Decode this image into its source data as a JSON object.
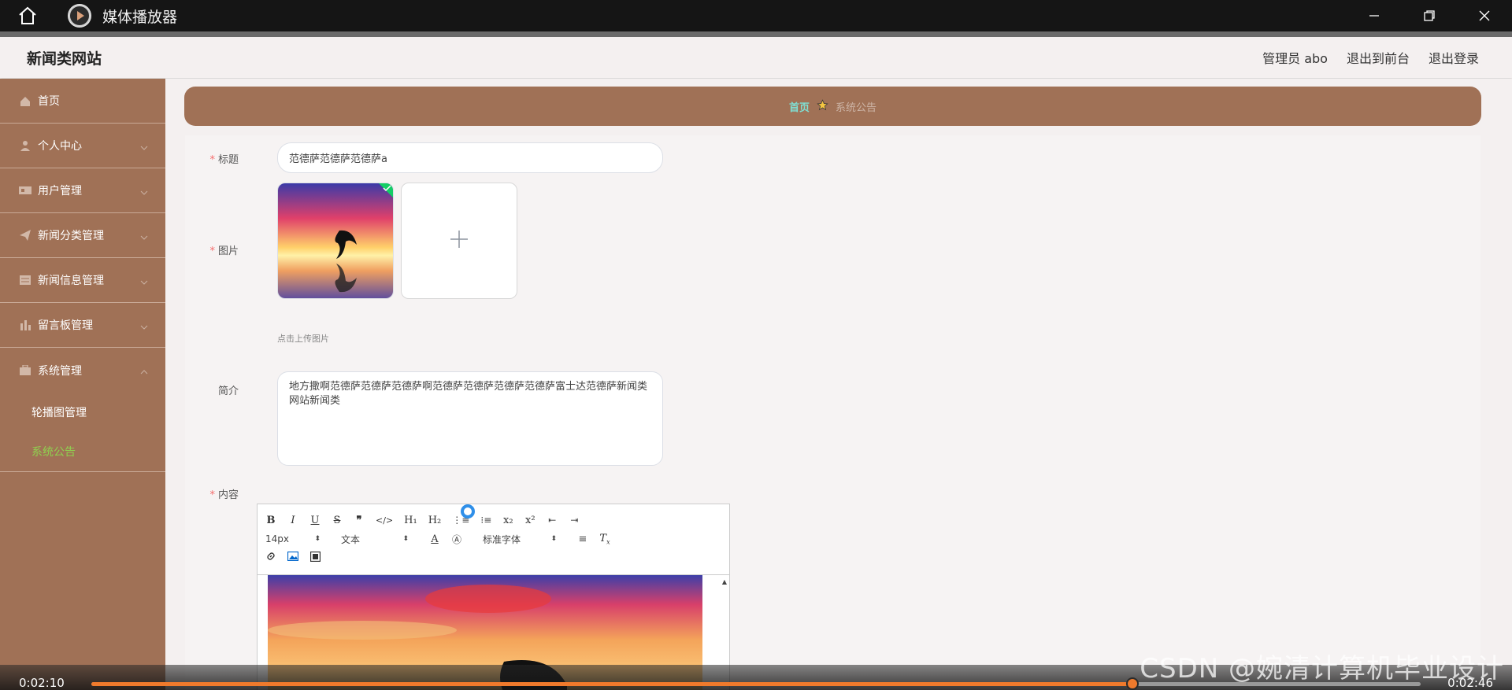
{
  "player": {
    "title": "媒体播放器",
    "current_time": "0:02:10",
    "total_time": "0:02:46",
    "progress": 0.783,
    "watermark": "CSDN @婉清计算机毕业设计"
  },
  "header": {
    "site_title": "新闻类网站",
    "admin": "管理员 abo",
    "to_front": "退出到前台",
    "logout": "退出登录"
  },
  "sidebar": {
    "items": [
      {
        "label": "首页",
        "icon": "home-icon"
      },
      {
        "label": "个人中心",
        "icon": "user-icon"
      },
      {
        "label": "用户管理",
        "icon": "users-icon"
      },
      {
        "label": "新闻分类管理",
        "icon": "send-icon"
      },
      {
        "label": "新闻信息管理",
        "icon": "list-icon"
      },
      {
        "label": "留言板管理",
        "icon": "chart-icon"
      },
      {
        "label": "系统管理",
        "icon": "briefcase-icon"
      }
    ],
    "sub_items": [
      {
        "label": "轮播图管理",
        "active": false
      },
      {
        "label": "系统公告",
        "active": true
      }
    ]
  },
  "breadcrumb": {
    "home": "首页",
    "current": "系统公告"
  },
  "form": {
    "title_label": "标题",
    "title_value": "范德萨范德萨范德萨a",
    "image_label": "图片",
    "upload_hint": "点击上传图片",
    "intro_label": "简介",
    "intro_value": "地方撒啊范德萨范德萨范德萨啊范德萨范德萨范德萨范德萨富士达范德萨新闻类网站新闻类",
    "content_label": "内容"
  },
  "editor": {
    "font_size": "14px",
    "text_type": "文本",
    "font_family": "标准字体"
  },
  "colors": {
    "sidebar": "#a07156",
    "accent_green": "#8fd14f",
    "progress": "#f07a2c"
  }
}
